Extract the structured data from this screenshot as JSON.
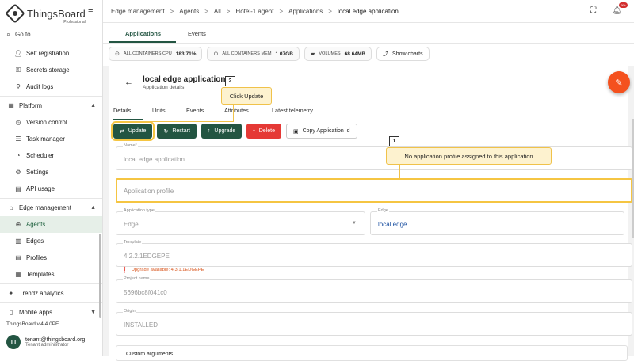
{
  "brand": {
    "name": "ThingsBoard",
    "edition": "Professional"
  },
  "sidebar": {
    "goto": "Go to...",
    "items": [
      {
        "label": "Self registration",
        "icon": "user-add-icon",
        "type": "sub"
      },
      {
        "label": "Secrets storage",
        "icon": "key-icon",
        "type": "sub"
      },
      {
        "label": "Audit logs",
        "icon": "audit-icon",
        "type": "sub"
      },
      {
        "label": "Platform",
        "icon": "platform-icon",
        "type": "top",
        "chevron": "up"
      },
      {
        "label": "Version control",
        "icon": "history-icon",
        "type": "sub"
      },
      {
        "label": "Task manager",
        "icon": "task-icon",
        "type": "sub"
      },
      {
        "label": "Scheduler",
        "icon": "clock-icon",
        "type": "sub"
      },
      {
        "label": "Settings",
        "icon": "gear-icon",
        "type": "sub"
      },
      {
        "label": "API usage",
        "icon": "chart-icon",
        "type": "sub"
      },
      {
        "label": "Edge management",
        "icon": "edge-icon",
        "type": "top",
        "chevron": "up"
      },
      {
        "label": "Agents",
        "icon": "agent-icon",
        "type": "sub",
        "active": true
      },
      {
        "label": "Edges",
        "icon": "edges-icon",
        "type": "sub"
      },
      {
        "label": "Profiles",
        "icon": "profiles-icon",
        "type": "sub"
      },
      {
        "label": "Templates",
        "icon": "templates-icon",
        "type": "sub"
      },
      {
        "label": "Trendz analytics",
        "icon": "trendz-icon",
        "type": "top"
      },
      {
        "label": "Mobile apps",
        "icon": "mobile-icon",
        "type": "top",
        "chevron": "down"
      }
    ],
    "version": "ThingsBoard v.4.4.0PE",
    "user": {
      "initials": "TT",
      "name": "tenant@thingsboard.org",
      "role": "Tenant administrator"
    }
  },
  "header": {
    "breadcrumb": [
      "Edge management",
      "Agents",
      "All",
      "Hotel-1 agent",
      "Applications",
      "local edge application"
    ],
    "notif_badge": "99+"
  },
  "tabs": [
    "Applications",
    "Events"
  ],
  "stats": [
    {
      "label": "ALL CONTAINERS CPU",
      "value": "183.71%"
    },
    {
      "label": "ALL CONTAINERS MEM",
      "value": "1.07GB"
    },
    {
      "label": "VOLUMES",
      "value": "68.64MB"
    }
  ],
  "show_charts": "Show charts",
  "detail": {
    "title": "local edge application",
    "subtitle": "Application details",
    "tabs": [
      "Details",
      "Units",
      "Events",
      "Attributes",
      "Latest telemetry"
    ],
    "buttons": {
      "update": "Update",
      "restart": "Restart",
      "upgrade": "Upgrade",
      "delete": "Delete",
      "copy": "Copy Application Id"
    },
    "name_label": "Name*",
    "name_value": "local edge application",
    "profile_placeholder": "Application profile",
    "type_label": "Application type",
    "type_value": "Edge",
    "edge_label": "Edge",
    "edge_value": "local edge",
    "template_label": "Template",
    "template_value": "4.2.2.1EDGEPE",
    "upgrade_warning": "Upgrade available: 4.3.1.1EDGEPE",
    "project_label": "Project name",
    "project_value": "5696bc8f041c0",
    "origin_label": "Origin",
    "origin_value": "INSTALLED",
    "custom_args": "Custom arguments"
  },
  "callouts": {
    "c1_num": "1",
    "c1_text": "No application profile assigned to this application",
    "c2_num": "2",
    "c2_text": "Click Update"
  },
  "colors": {
    "primary": "#235542",
    "danger": "#e53935",
    "fab": "#f4511e",
    "highlight": "#f5c542"
  }
}
